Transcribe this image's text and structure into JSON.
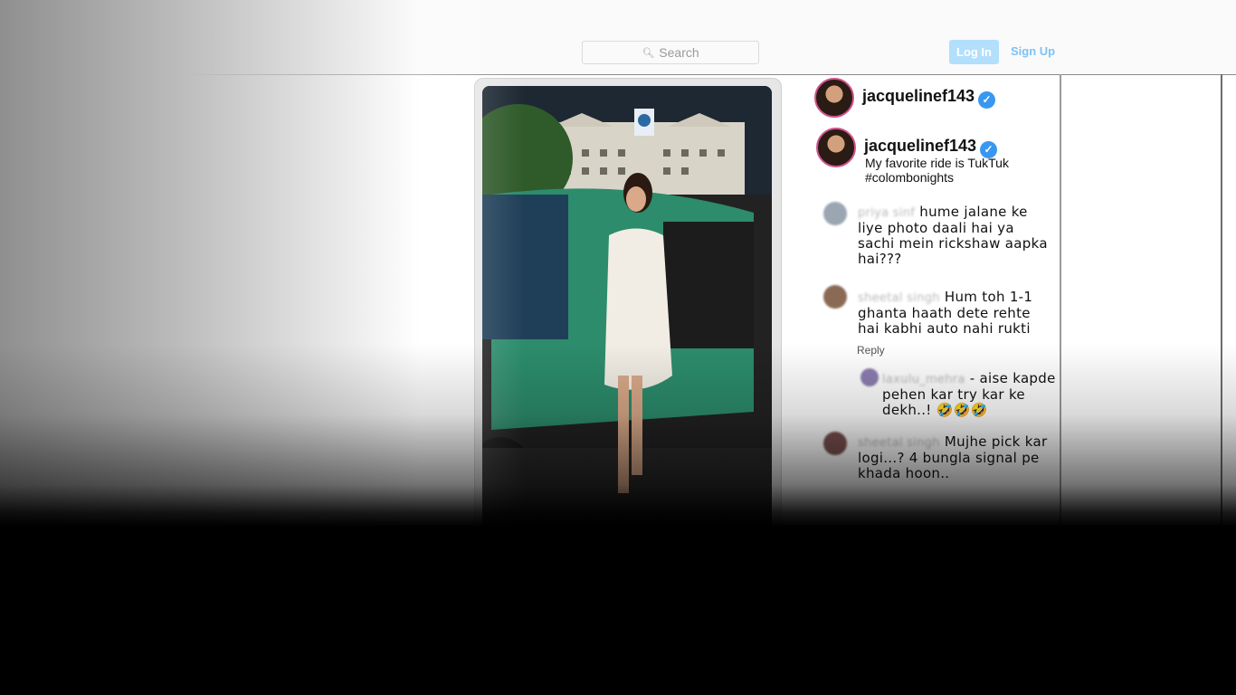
{
  "header": {
    "search_placeholder": "Search",
    "login_label": "Log In",
    "signup_label": "Sign Up"
  },
  "post": {
    "username": "jacquelinef143",
    "caption_username": "jacquelinef143",
    "caption_text": "My favorite ride is TukTuk #colombonights"
  },
  "comments": [
    {
      "user": "priya sinf",
      "text": "hume jalane ke liye photo daali hai ya sachi mein rickshaw aapka hai???"
    },
    {
      "user": "sheetal singh",
      "text": "Hum toh 1-1 ghanta haath dete rehte hai kabhi auto nahi rukti"
    },
    {
      "user": "laxulu_mehra",
      "text": "- aise kapde pehen kar try kar ke dekh..! 🤣🤣🤣"
    },
    {
      "user": "sheetal singh",
      "text": "Mujhe pick kar logi...? 4 bungla signal pe khada hoon.."
    }
  ],
  "reply_label": "Reply",
  "colors": {
    "accent": "#3897f0",
    "login_bg": "#b2dffc",
    "signup": "#7dc2f5"
  },
  "icons": [
    "search-icon",
    "verified-icon"
  ]
}
